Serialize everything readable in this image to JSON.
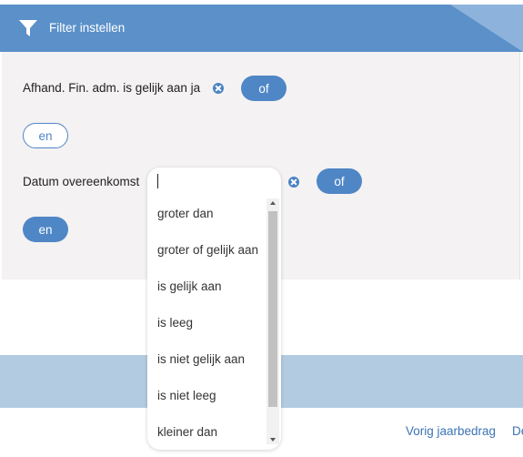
{
  "header": {
    "title": "Filter instellen",
    "icon": "funnel-icon"
  },
  "conditions": [
    {
      "text": "Afhand. Fin. adm. is gelijk aan ja",
      "clear_icon": "clear-icon",
      "or_label": "of"
    },
    {
      "text": "Datum overeenkomst",
      "clear_icon": "clear-icon",
      "or_label": "of"
    }
  ],
  "and_buttons": [
    "en",
    "en"
  ],
  "operator_dropdown": {
    "input_value": "",
    "options": [
      "groter dan",
      "groter of gelijk aan",
      "is gelijk aan",
      "is leeg",
      "is niet gelijk aan",
      "is niet leeg",
      "kleiner dan"
    ]
  },
  "footer": {
    "links": [
      "Vorig jaarbedrag",
      "De"
    ]
  },
  "colors": {
    "header": "#5b90c9",
    "accent": "#4f86c6",
    "panel": "#f4f2f2",
    "band": "#b3cbe0",
    "link": "#3b74b4"
  }
}
